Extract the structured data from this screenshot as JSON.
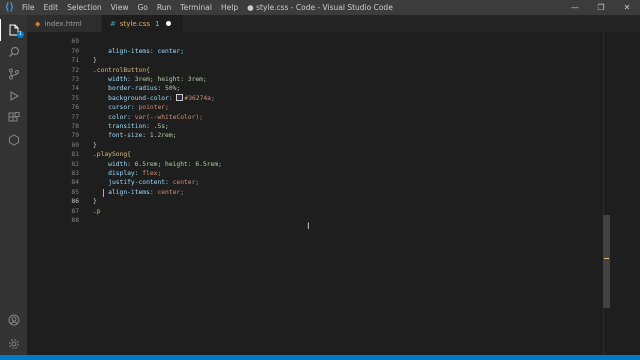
{
  "window": {
    "title": "● style.css - Code - Visual Studio Code",
    "logo": "vscode-logo",
    "controls": {
      "minimize": "—",
      "maximize": "❐",
      "close": "✕"
    }
  },
  "menu": [
    "File",
    "Edit",
    "Selection",
    "View",
    "Go",
    "Run",
    "Terminal",
    "Help"
  ],
  "activity": {
    "items": [
      "files-icon",
      "search-icon",
      "source-control-icon",
      "run-debug-icon",
      "extensions-icon",
      "remote-icon",
      "account-icon",
      "settings-gear-icon"
    ],
    "explorer_badge": "1"
  },
  "tabs": [
    {
      "label": "index.html",
      "icon": "html-file-icon",
      "active": false
    },
    {
      "label": "style.css",
      "icon": "css-file-icon",
      "active": true,
      "count": "1",
      "unsaved": true
    }
  ],
  "editor": {
    "lines": [
      {
        "n": "69",
        "code": "    align-items: center;"
      },
      {
        "n": "70",
        "code": "}"
      },
      {
        "n": "71",
        "code": ".controlButton{"
      },
      {
        "n": "72",
        "code": "    width: 3rem; height: 3rem;"
      },
      {
        "n": "73",
        "code": "    border-radius: 50%;"
      },
      {
        "n": "74",
        "code": "    background-color: #36274a;"
      },
      {
        "n": "75",
        "code": "    cursor: pointer;"
      },
      {
        "n": "76",
        "code": "    color: var(--whiteColor);"
      },
      {
        "n": "77",
        "code": "    transition: .5s;"
      },
      {
        "n": "78",
        "code": "    font-size: 1.2rem;"
      },
      {
        "n": "79",
        "code": "}"
      },
      {
        "n": "80",
        "code": ".playSong{"
      },
      {
        "n": "81",
        "code": "    width: 6.5rem; height: 6.5rem;"
      },
      {
        "n": "82",
        "code": "    display: flex;"
      },
      {
        "n": "83",
        "code": "    justify-content: center;"
      },
      {
        "n": "84",
        "code": "    align-items: center;"
      },
      {
        "n": "85",
        "code": "}"
      },
      {
        "n": "86",
        "code": ".p"
      },
      {
        "n": "87",
        "code": ""
      },
      {
        "n": "88",
        "code": ""
      }
    ]
  },
  "colors": {
    "accent": "#007acc",
    "swatch": "#36274a",
    "selector": "#d7ba7d",
    "property": "#9cdcfe",
    "number": "#b5cea8",
    "value": "#ce9178"
  }
}
